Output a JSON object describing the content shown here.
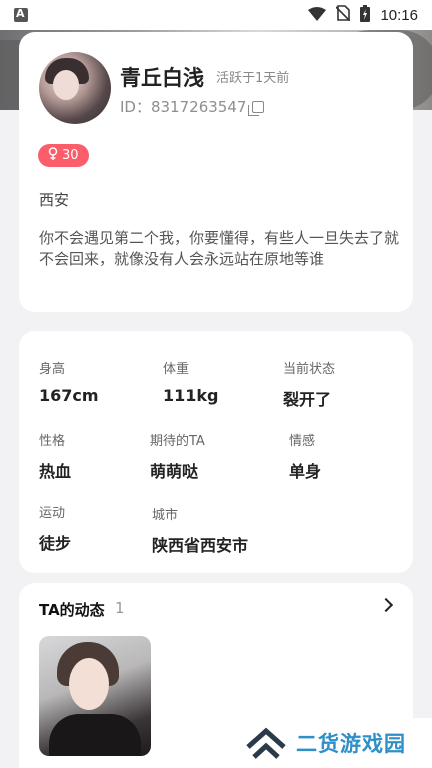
{
  "status_bar": {
    "time": "10:16"
  },
  "profile": {
    "nickname": "青丘白浅",
    "active": "活跃于1天前",
    "id_label": "ID：8317263547",
    "badge_count": "30",
    "location": "西安",
    "bio": "你不会遇见第二个我，你要懂得，有些人一旦失去了就不会回来，就像没有人会永远站在原地等谁"
  },
  "details": {
    "height": {
      "label": "身高",
      "value": "167cm"
    },
    "weight": {
      "label": "体重",
      "value": "111kg"
    },
    "status": {
      "label": "当前状态",
      "value": "裂开了"
    },
    "personality": {
      "label": "性格",
      "value": "热血"
    },
    "expected": {
      "label": "期待的TA",
      "value": "萌萌哒"
    },
    "emotion": {
      "label": "情感",
      "value": "单身"
    },
    "sport": {
      "label": "运动",
      "value": "徒步"
    },
    "city": {
      "label": "城市",
      "value": "陕西省西安市"
    }
  },
  "moments": {
    "title": "TA的动态",
    "count": "1"
  },
  "watermark": {
    "text": "二货游戏园"
  },
  "colors": {
    "badge": "#fb5d6a",
    "watermark": "#2f8fc7",
    "background": "#f2f2f4"
  }
}
